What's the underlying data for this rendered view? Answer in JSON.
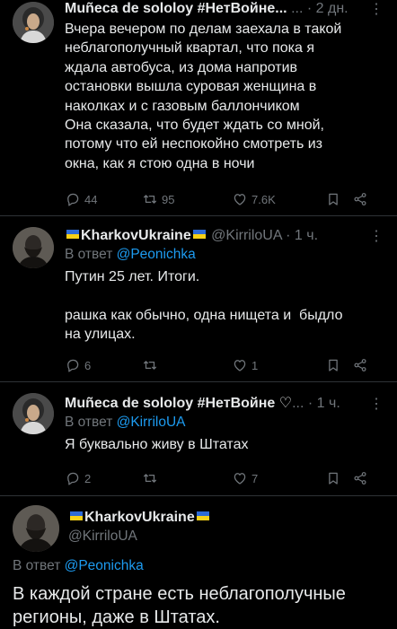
{
  "tweets": [
    {
      "author": "Muñeca de sololoy #НетВойне...",
      "dots": "...",
      "time": "· 2 дн.",
      "text": "Вчера вечером по делам заехала в такой\nнеблагополучный квартал, что пока я\nждала автобуса, из дома напротив\nостановки вышла суровая женщина в\nнаколках и с газовым баллончиком\nОна сказала, что будет ждать со мной,\nпотому что ей неспокойно смотреть из\nокна, как я стою одна в ночи",
      "replies": "44",
      "retweets": "95",
      "likes": "7.6K"
    },
    {
      "author": "KharkovUkraine",
      "handle": "@KirriloUA",
      "time": "· 1 ч.",
      "reply_prefix": "В ответ",
      "reply_to": "@Peonichka",
      "text": "Путин 25 лет. Итоги.\n\nрашка как обычно, одна нищета и  быдло\nна улицах.",
      "replies": "6",
      "retweets": "",
      "likes": "1"
    },
    {
      "author": "Muñeca de sololoy #НетВойне",
      "author_suffix": "...",
      "time": "· 1 ч.",
      "reply_prefix": "В ответ",
      "reply_to": "@KirriloUA",
      "text": "Я буквально живу в Штатах",
      "replies": "2",
      "retweets": "",
      "likes": "7"
    },
    {
      "author": "KharkovUkraine",
      "handle": "@KirriloUA",
      "reply_prefix": "В ответ",
      "reply_to": "@Peonichka",
      "text": "В каждой стране есть неблагополучные\nрегионы, даже в Штатах."
    }
  ],
  "icons": [
    "reply-icon",
    "retweet-icon",
    "like-icon",
    "bookmark-icon",
    "share-icon",
    "more-icon",
    "heart-emoji",
    "ukraine-flag"
  ],
  "colors": {
    "background": "#000000",
    "text": "#e7e9ea",
    "muted": "#71767b",
    "link": "#1d9bf0"
  }
}
